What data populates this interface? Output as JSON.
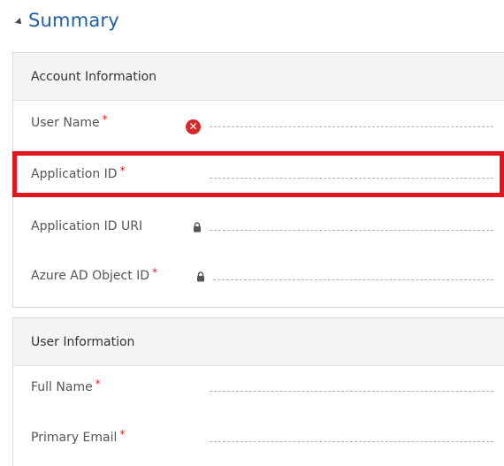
{
  "summary": {
    "title": "Summary",
    "collapse_icon": "collapse-triangle-icon"
  },
  "account_section": {
    "title": "Account Information",
    "fields": [
      {
        "label": "User Name",
        "required": "*",
        "icon": "error-icon",
        "value": ""
      },
      {
        "label": "Application ID",
        "required": "*",
        "icon": "",
        "value": "",
        "highlighted": true
      },
      {
        "label": "Application ID URI",
        "required": "",
        "icon": "lock-icon",
        "value": ""
      },
      {
        "label": "Azure AD Object ID",
        "required": "*",
        "icon": "lock-icon",
        "value": ""
      }
    ]
  },
  "user_section": {
    "title": "User Information",
    "fields": [
      {
        "label": "Full Name",
        "required": "*",
        "icon": "",
        "value": ""
      },
      {
        "label": "Primary Email",
        "required": "*",
        "icon": "",
        "value": ""
      }
    ]
  },
  "colors": {
    "summary_title": "#1f5fa8",
    "required_marker": "#d02626",
    "error_icon": "#d42a2a",
    "highlight_border": "#e0171e",
    "section_header_bg": "#f4f4f4"
  }
}
